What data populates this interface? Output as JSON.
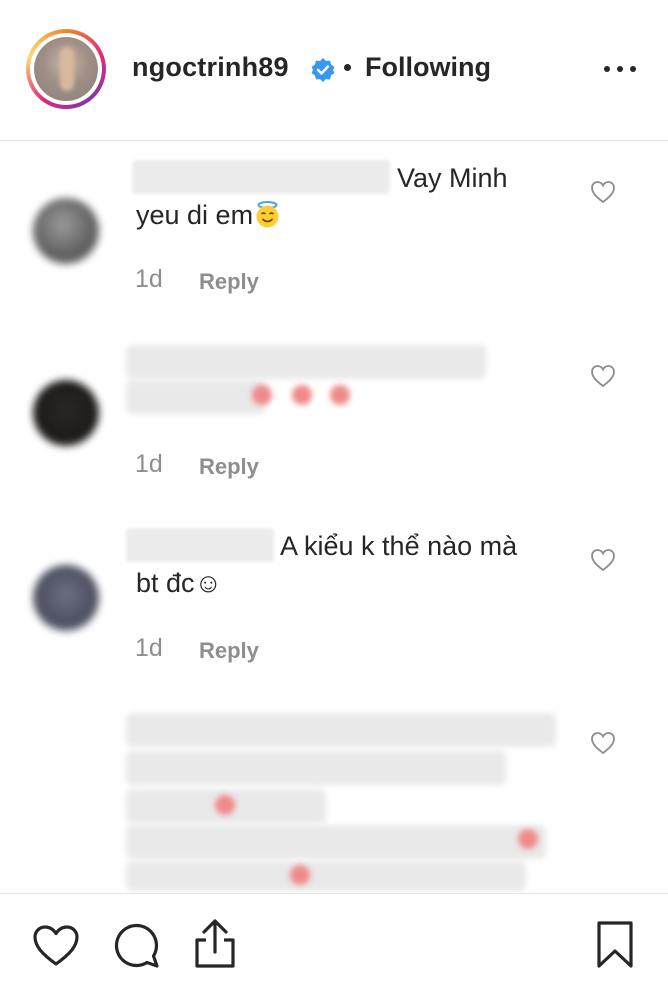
{
  "header": {
    "username": "ngoctrinh89",
    "verified_icon": "verified-badge-icon",
    "separator": "•",
    "follow_status": "Following",
    "more_icon": "more-options-icon"
  },
  "comments": [
    {
      "text_line1": "Vay Minh",
      "text_line2": "yeu di em",
      "emoji": "smiling-face-with-halo",
      "time": "1d",
      "reply": "Reply"
    },
    {
      "time": "1d",
      "reply": "Reply"
    },
    {
      "text_line1": "A kiểu k thể nào mà",
      "text_line2": "bt đc☺",
      "time": "1d",
      "reply": "Reply"
    },
    {}
  ],
  "colors": {
    "text": "#262626",
    "muted": "#8e8e8e",
    "verified": "#3897f0",
    "divider": "#e6e6e6"
  },
  "actions": {
    "like": "heart-icon",
    "comment": "comment-bubble-icon",
    "share": "share-upload-icon",
    "save": "bookmark-icon"
  }
}
